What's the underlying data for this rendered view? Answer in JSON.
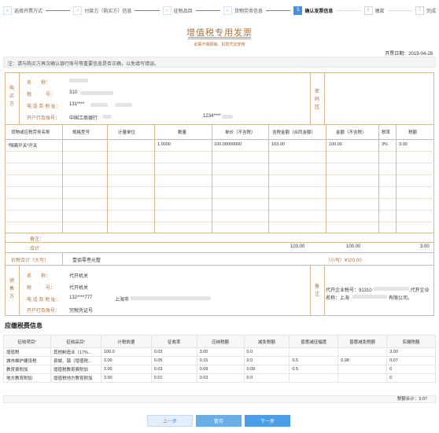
{
  "steps": [
    {
      "num": "✓",
      "label": "选择开票方式",
      "state": "done"
    },
    {
      "num": "✓",
      "label": "付款方（购买方）信息",
      "state": "done"
    },
    {
      "num": "✓",
      "label": "征税品目",
      "state": "done"
    },
    {
      "num": "✓",
      "label": "货物劳务信息",
      "state": "done"
    },
    {
      "num": "5",
      "label": "确认发票信息",
      "state": "active"
    },
    {
      "num": "6",
      "label": "缴款",
      "state": "todo"
    },
    {
      "num": "7",
      "label": "完成",
      "state": "todo"
    }
  ],
  "invoice": {
    "title": "增值税专用发票",
    "subtitle": "此联不做报销、扣款凭证使用",
    "issue_date": "开票日期：2019-04-28",
    "notice": "注：请与购买方再次确认银行账号等重要信息是否正确，以免填写错误。",
    "buyer": {
      "side_label": "购买方",
      "name_label": "名　　称：",
      "tax_label": "税　　　号：",
      "tax_value": "310",
      "addr_label": "电 话 及 地 址：",
      "addr_value": "131****",
      "bank_label": "开户行及账号：",
      "bank_value": "中国工商银行",
      "account_value": "1234****"
    },
    "password_label": "密码区",
    "goods_headers": [
      "货物或应税劳务名称",
      "规格型号",
      "计量单位",
      "数量",
      "单价（不含税）",
      "含税金额（合同金额）",
      "金额（不含税）",
      "税率",
      "税额"
    ],
    "goods_rows": [
      {
        "name": "*隔离开关*开关",
        "spec": "",
        "unit": "",
        "qty": "1.0000",
        "price": "100.00000000",
        "gross": "103.00",
        "net": "100.00",
        "rate": "3%",
        "tax": "3.00"
      }
    ],
    "remark_label": "备注：",
    "total_label": "合计",
    "total_gross": "103.00",
    "total_net": "100.00",
    "total_tax": "3.00",
    "price_tax_label": "价税合计（大写）",
    "price_tax_upper": "壹佰零叁元整",
    "price_tax_lower": "（小写）¥103.00",
    "seller": {
      "side_label": "销售方",
      "name_label": "名　　称：",
      "name_value": "代开机关",
      "tax_label": "税　　　号：",
      "tax_value": "代开机关",
      "addr_label": "电 话 及 地 址：",
      "addr_value": "132****777",
      "addr_city": "上海市",
      "bank_label": "开户行及账号：",
      "bank_value": "完税凭证号"
    },
    "remark_side_label": "备注",
    "remark_text_1": "代开企业税号：91310",
    "remark_text_1b": ",代开企业",
    "remark_text_2": "名称：上海",
    "remark_text_2b": "有限公司。"
  },
  "tax_section": {
    "title": "应缴税费信息",
    "headers": [
      "征收项目",
      "征收品目",
      "计税依据",
      "征收率",
      "应纳税额",
      "减免税额",
      "普惠减征幅度",
      "普惠减免税额",
      "实缴税额"
    ],
    "required_cols": [
      0,
      1
    ],
    "rows": [
      [
        "增值税",
        "其他制造业（17%...",
        "100.0",
        "0.03",
        "3.00",
        "0.0",
        "",
        "",
        "3.00"
      ],
      [
        "城市维护建设税",
        "县城、镇（增值税...",
        "3.00",
        "0.05",
        "0.15",
        "0.0",
        "0.5",
        "0.08",
        "0.07"
      ],
      [
        "教育费附加",
        "增值税教育费附加",
        "3.00",
        "0.03",
        "0.09",
        "0.09",
        "0.5",
        "",
        "0"
      ],
      [
        "地方教育附加",
        "增值税地方教育附加",
        "3.00",
        "0.01",
        "0.03",
        "0.0",
        "",
        "",
        "0"
      ]
    ],
    "total": "税额合计：3.07"
  },
  "buttons": {
    "prev": "上一步",
    "save": "暂存",
    "next": "下一步"
  }
}
